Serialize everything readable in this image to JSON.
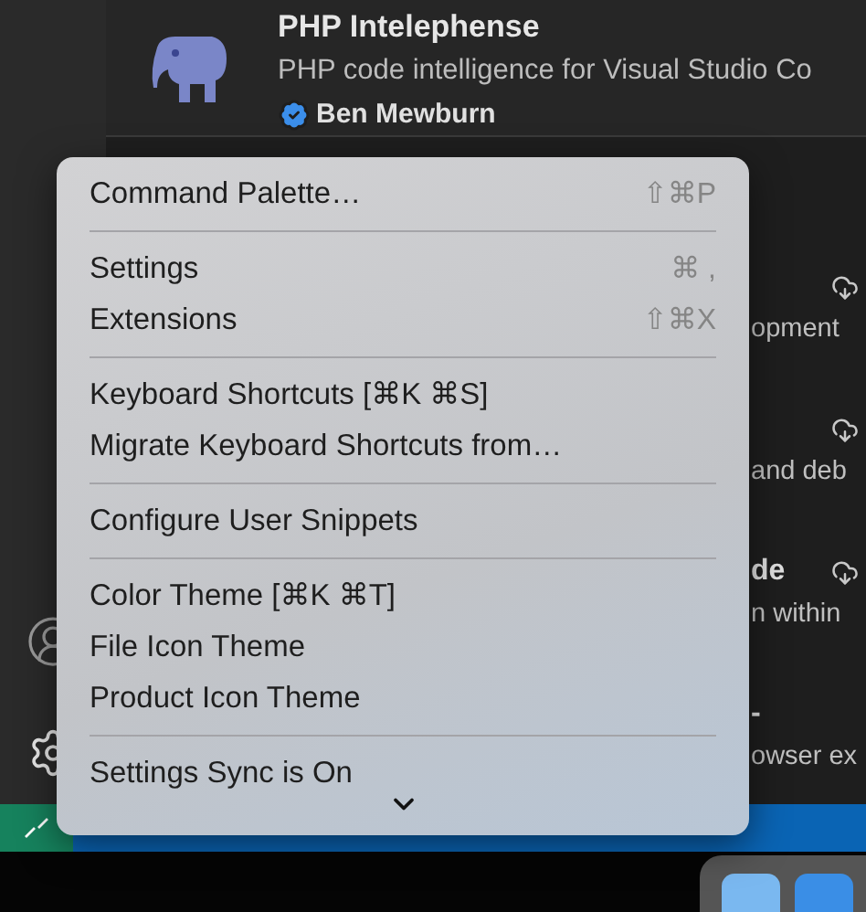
{
  "extension": {
    "name": "PHP Intelephense",
    "description": "PHP code intelligence for Visual Studio Co",
    "publisher": "Ben Mewburn",
    "verified": true
  },
  "background_rows": [
    {
      "description": "opment",
      "download": true
    },
    {
      "description": "and deb",
      "download": true
    },
    {
      "title": "de",
      "description": "n within",
      "download": true
    },
    {
      "title": "-",
      "description": "owser ex",
      "download": false
    }
  ],
  "menu": {
    "groups": [
      [
        {
          "label": "Command Palette…",
          "shortcut": "⇧⌘P"
        }
      ],
      [
        {
          "label": "Settings",
          "shortcut": "⌘ ,"
        },
        {
          "label": "Extensions",
          "shortcut": "⇧⌘X"
        }
      ],
      [
        {
          "label": "Keyboard Shortcuts [⌘K ⌘S]"
        },
        {
          "label": "Migrate Keyboard Shortcuts from…"
        }
      ],
      [
        {
          "label": "Configure User Snippets"
        }
      ],
      [
        {
          "label": "Color Theme [⌘K ⌘T]"
        },
        {
          "label": "File Icon Theme"
        },
        {
          "label": "Product Icon Theme"
        }
      ],
      [
        {
          "label": "Settings Sync is On"
        }
      ]
    ],
    "more_below": true
  }
}
